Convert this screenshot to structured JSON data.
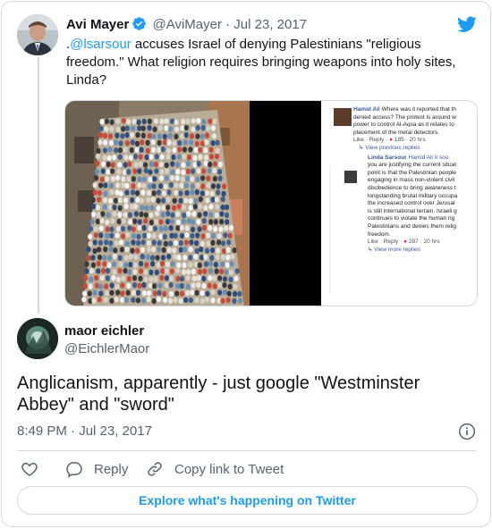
{
  "parent_tweet": {
    "author_name": "Avi Mayer",
    "handle": "@AviMayer",
    "separator": "·",
    "date": "Jul 23, 2017",
    "text_prefix": ".",
    "mention": "@lsarsour",
    "text_body": " accuses Israel of denying Palestinians \"religious freedom.\" What religion requires bringing weapons into holy sites, Linda?",
    "screenshot": {
      "comment1_author": "Hamid Ali",
      "comment1_lines": [
        "Where was it reported that th",
        "denied access? The protest is around w",
        "power to control Al-Aqsa as it relates to",
        "placement of the metal detectors."
      ],
      "comment1_meta": "Like · Reply ·",
      "comment1_reacts": "185",
      "comment1_time": "· 20 hrs",
      "view_previous": "View previous replies",
      "reply_author": "Linda Sarsour",
      "reply_mention": "Hamid Ali it sou",
      "reply_lines": [
        "you are justifying the current situat",
        "point is that the Palestinian people",
        "engaging in mass non-violent civil",
        "disobedience to bring awareness t",
        "longstanding brutal military occupa",
        "the increased control over Jerusal",
        "is still international terrain. Israeli g",
        "continues to violate the human rig",
        "Palestinians and denies them relig",
        "freedom."
      ],
      "reply_meta": "Like · Reply ·",
      "reply_reacts": "287",
      "reply_time": "· 20 hrs",
      "view_more": "View more replies"
    }
  },
  "main_tweet": {
    "author_name": "maor eichler",
    "handle": "@EichlerMaor",
    "text": "Anglicanism, apparently - just google \"Westminster Abbey\" and \"sword\"",
    "timestamp": "8:49 PM · Jul 23, 2017"
  },
  "actions": {
    "reply_label": "Reply",
    "copy_link_label": "Copy link to Tweet"
  },
  "explore_label": "Explore what's happening on Twitter",
  "colors": {
    "accent": "#1d9bf0",
    "text": "#0f1419",
    "muted": "#536471",
    "border": "#cfd9de"
  },
  "icons": [
    "twitter-bird-icon",
    "verified-badge-icon",
    "info-icon",
    "heart-icon",
    "reply-icon",
    "link-icon"
  ]
}
